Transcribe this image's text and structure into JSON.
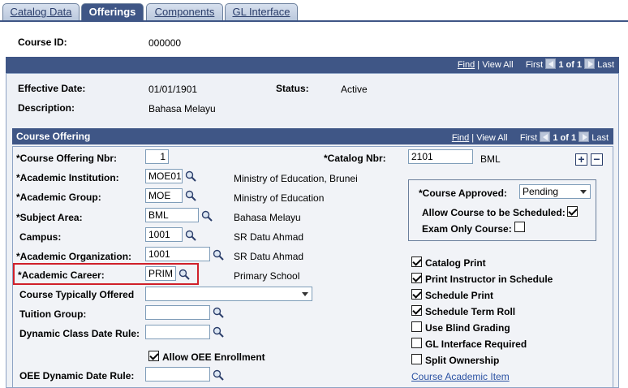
{
  "tabs": [
    {
      "label": "Catalog Data"
    },
    {
      "label": "Offerings"
    },
    {
      "label": "Components"
    },
    {
      "label": "GL Interface"
    }
  ],
  "course": {
    "id_label": "Course ID:",
    "id_value": "000000"
  },
  "outer_nav": {
    "find": "Find",
    "view_all": "View All",
    "first": "First",
    "count": "1 of 1",
    "last": "Last"
  },
  "header": {
    "effective_date_label": "Effective Date:",
    "effective_date_value": "01/01/1901",
    "status_label": "Status:",
    "status_value": "Active",
    "description_label": "Description:",
    "description_value": "Bahasa Melayu"
  },
  "offering": {
    "title": "Course Offering",
    "nav": {
      "find": "Find",
      "view_all": "View All",
      "first": "First",
      "count": "1 of 1",
      "last": "Last"
    },
    "fields": {
      "offering_nbr": {
        "label": "*Course Offering Nbr:",
        "value": "1"
      },
      "institution": {
        "label": "*Academic Institution:",
        "value": "MOE01",
        "desc": "Ministry of Education, Brunei"
      },
      "group": {
        "label": "*Academic Group:",
        "value": "MOE",
        "desc": "Ministry of Education"
      },
      "subject": {
        "label": "*Subject Area:",
        "value": "BML",
        "desc": "Bahasa Melayu"
      },
      "campus": {
        "label": "Campus:",
        "value": "1001",
        "desc": "SR Datu Ahmad"
      },
      "organization": {
        "label": "*Academic Organization:",
        "value": "1001",
        "desc": "SR Datu Ahmad"
      },
      "career": {
        "label": "*Academic Career:",
        "value": "PRIM",
        "desc": "Primary School"
      },
      "typically_offered": {
        "label": "Course Typically Offered",
        "value": ""
      },
      "tuition_group": {
        "label": "Tuition Group:",
        "value": ""
      },
      "dynamic_class_date": {
        "label": "Dynamic Class Date Rule:",
        "value": ""
      },
      "allow_oee": {
        "label": "Allow OEE Enrollment",
        "checked": true
      },
      "oee_dynamic_date": {
        "label": "OEE Dynamic Date Rule:",
        "value": ""
      },
      "catalog_nbr": {
        "label": "*Catalog Nbr:",
        "value": "2101",
        "desc": "BML"
      }
    },
    "approval": {
      "approved_label": "*Course Approved:",
      "approved_value": "Pending",
      "allow_scheduled_label": "Allow Course to be Scheduled:",
      "allow_scheduled_checked": true,
      "exam_only_label": "Exam Only Course:",
      "exam_only_checked": false
    },
    "checkboxes": [
      {
        "label": "Catalog Print",
        "checked": true
      },
      {
        "label": "Print Instructor in Schedule",
        "checked": true
      },
      {
        "label": "Schedule Print",
        "checked": true
      },
      {
        "label": "Schedule Term Roll",
        "checked": true
      },
      {
        "label": "Use Blind Grading",
        "checked": false
      },
      {
        "label": "GL Interface Required",
        "checked": false
      },
      {
        "label": "Split Ownership",
        "checked": false
      }
    ],
    "academic_item_link": "Course Academic Item",
    "add_symbol": "+",
    "remove_symbol": "−"
  },
  "colors": {
    "bar": "#3f5686",
    "highlight": "#d0202a",
    "link": "#2b52a3"
  }
}
